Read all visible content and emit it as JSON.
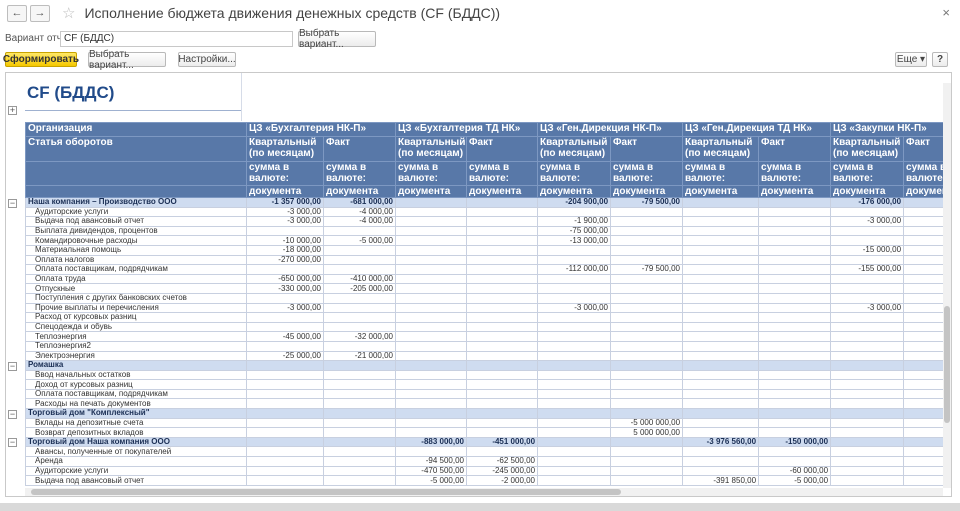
{
  "window": {
    "title": "Исполнение бюджета движения денежных средств (CF (БДДС))",
    "back_icon": "←",
    "forward_icon": "→",
    "star_icon": "☆",
    "close_icon": "×"
  },
  "toolbar": {
    "variant_label": "Вариант отчета:",
    "variant_value": "CF (БДДС)",
    "select_variant_top": "Выбрать вариант...",
    "generate": "Сформировать",
    "select_variant": "Выбрать вариант...",
    "settings": "Настройки...",
    "more": "Еще ▾",
    "help": "?"
  },
  "report": {
    "title": "CF (БДДС)",
    "header": {
      "org_label": "Организация",
      "article_label": "Статья оборотов",
      "departments": [
        "ЦЗ «Бухгалтерия НК-П»",
        "ЦЗ «Бухгалтерия ТД НК»",
        "ЦЗ «Ген.Дирекция НК-П»",
        "ЦЗ «Ген.Дирекция ТД НК»",
        "ЦЗ «Закупки НК-П»"
      ],
      "plan_label": "Квартальный (по месяцам)",
      "fact_label": "Факт",
      "sum_label": "сумма в валюте:",
      "doc_label": "документа"
    },
    "rows": [
      {
        "type": "group",
        "name": "Наша компания – Производство ООО",
        "v": [
          "-1 357 000,00",
          "-681 000,00",
          "",
          "",
          "-204 900,00",
          "-79 500,00",
          "",
          "",
          "-176 000,00",
          ""
        ]
      },
      {
        "type": "item",
        "name": "Аудиторские услуги",
        "v": [
          "-3 000,00",
          "-4 000,00",
          "",
          "",
          "",
          "",
          "",
          "",
          "",
          ""
        ]
      },
      {
        "type": "item",
        "name": "Выдача под авансовый отчет",
        "v": [
          "-3 000,00",
          "-4 000,00",
          "",
          "",
          "-1 900,00",
          "",
          "",
          "",
          "-3 000,00",
          ""
        ]
      },
      {
        "type": "item",
        "name": "Выплата дивидендов, процентов",
        "v": [
          "",
          "",
          "",
          "",
          "-75 000,00",
          "",
          "",
          "",
          "",
          ""
        ]
      },
      {
        "type": "item",
        "name": "Командировочные расходы",
        "v": [
          "-10 000,00",
          "-5 000,00",
          "",
          "",
          "-13 000,00",
          "",
          "",
          "",
          "",
          ""
        ]
      },
      {
        "type": "item",
        "name": "Материальная помощь",
        "v": [
          "-18 000,00",
          "",
          "",
          "",
          "",
          "",
          "",
          "",
          "-15 000,00",
          ""
        ]
      },
      {
        "type": "item",
        "name": "Оплата налогов",
        "v": [
          "-270 000,00",
          "",
          "",
          "",
          "",
          "",
          "",
          "",
          "",
          ""
        ]
      },
      {
        "type": "item",
        "name": "Оплата поставщикам, подрядчикам",
        "v": [
          "",
          "",
          "",
          "",
          "-112 000,00",
          "-79 500,00",
          "",
          "",
          "-155 000,00",
          ""
        ]
      },
      {
        "type": "item",
        "name": "Оплата труда",
        "v": [
          "-650 000,00",
          "-410 000,00",
          "",
          "",
          "",
          "",
          "",
          "",
          "",
          ""
        ]
      },
      {
        "type": "item",
        "name": "Отпускные",
        "v": [
          "-330 000,00",
          "-205 000,00",
          "",
          "",
          "",
          "",
          "",
          "",
          "",
          ""
        ]
      },
      {
        "type": "item",
        "name": "Поступления с других банковских счетов",
        "v": [
          "",
          "",
          "",
          "",
          "",
          "",
          "",
          "",
          "",
          ""
        ]
      },
      {
        "type": "item",
        "name": "Прочие выплаты и перечисления",
        "v": [
          "-3 000,00",
          "",
          "",
          "",
          "-3 000,00",
          "",
          "",
          "",
          "-3 000,00",
          ""
        ]
      },
      {
        "type": "item",
        "name": "Расход от курсовых разниц",
        "v": [
          "",
          "",
          "",
          "",
          "",
          "",
          "",
          "",
          "",
          ""
        ]
      },
      {
        "type": "item",
        "name": "Спецодежда и обувь",
        "v": [
          "",
          "",
          "",
          "",
          "",
          "",
          "",
          "",
          "",
          ""
        ]
      },
      {
        "type": "item",
        "name": "Теплоэнергия",
        "v": [
          "-45 000,00",
          "-32 000,00",
          "",
          "",
          "",
          "",
          "",
          "",
          "",
          ""
        ]
      },
      {
        "type": "item",
        "name": "Теплоэнергия2",
        "v": [
          "",
          "",
          "",
          "",
          "",
          "",
          "",
          "",
          "",
          ""
        ]
      },
      {
        "type": "item",
        "name": "Электроэнергия",
        "v": [
          "-25 000,00",
          "-21 000,00",
          "",
          "",
          "",
          "",
          "",
          "",
          "",
          ""
        ]
      },
      {
        "type": "group",
        "name": "Ромашка",
        "v": [
          "",
          "",
          "",
          "",
          "",
          "",
          "",
          "",
          "",
          ""
        ]
      },
      {
        "type": "item",
        "name": "Ввод начальных остатков",
        "v": [
          "",
          "",
          "",
          "",
          "",
          "",
          "",
          "",
          "",
          ""
        ]
      },
      {
        "type": "item",
        "name": "Доход от курсовых разниц",
        "v": [
          "",
          "",
          "",
          "",
          "",
          "",
          "",
          "",
          "",
          ""
        ]
      },
      {
        "type": "item",
        "name": "Оплата поставщикам, подрядчикам",
        "v": [
          "",
          "",
          "",
          "",
          "",
          "",
          "",
          "",
          "",
          ""
        ]
      },
      {
        "type": "item",
        "name": "Расходы на печать документов",
        "v": [
          "",
          "",
          "",
          "",
          "",
          "",
          "",
          "",
          "",
          ""
        ]
      },
      {
        "type": "group",
        "name": "Торговый дом \"Комплексный\"",
        "v": [
          "",
          "",
          "",
          "",
          "",
          "",
          "",
          "",
          "",
          ""
        ]
      },
      {
        "type": "item",
        "name": "Вклады на депозитные счета",
        "v": [
          "",
          "",
          "",
          "",
          "",
          "-5 000 000,00",
          "",
          "",
          "",
          ""
        ]
      },
      {
        "type": "item",
        "name": "Возврат депозитных вкладов",
        "v": [
          "",
          "",
          "",
          "",
          "",
          "5 000 000,00",
          "",
          "",
          "",
          ""
        ]
      },
      {
        "type": "group",
        "name": "Торговый дом Наша компания ООО",
        "v": [
          "",
          "",
          "-883 000,00",
          "-451 000,00",
          "",
          "",
          "-3 976 560,00",
          "-150 000,00",
          "",
          ""
        ]
      },
      {
        "type": "item",
        "name": "Авансы, полученные от покупателей",
        "v": [
          "",
          "",
          "",
          "",
          "",
          "",
          "",
          "",
          "",
          ""
        ]
      },
      {
        "type": "item",
        "name": "Аренда",
        "v": [
          "",
          "",
          "-94 500,00",
          "-62 500,00",
          "",
          "",
          "",
          "",
          "",
          ""
        ]
      },
      {
        "type": "item",
        "name": "Аудиторские услуги",
        "v": [
          "",
          "",
          "-470 500,00",
          "-245 000,00",
          "",
          "",
          "",
          "-60 000,00",
          "",
          ""
        ]
      },
      {
        "type": "item",
        "name": "Выдача под авансовый отчет",
        "v": [
          "",
          "",
          "-5 000,00",
          "-2 000,00",
          "",
          "",
          "-391 850,00",
          "-5 000,00",
          "",
          ""
        ]
      }
    ]
  }
}
